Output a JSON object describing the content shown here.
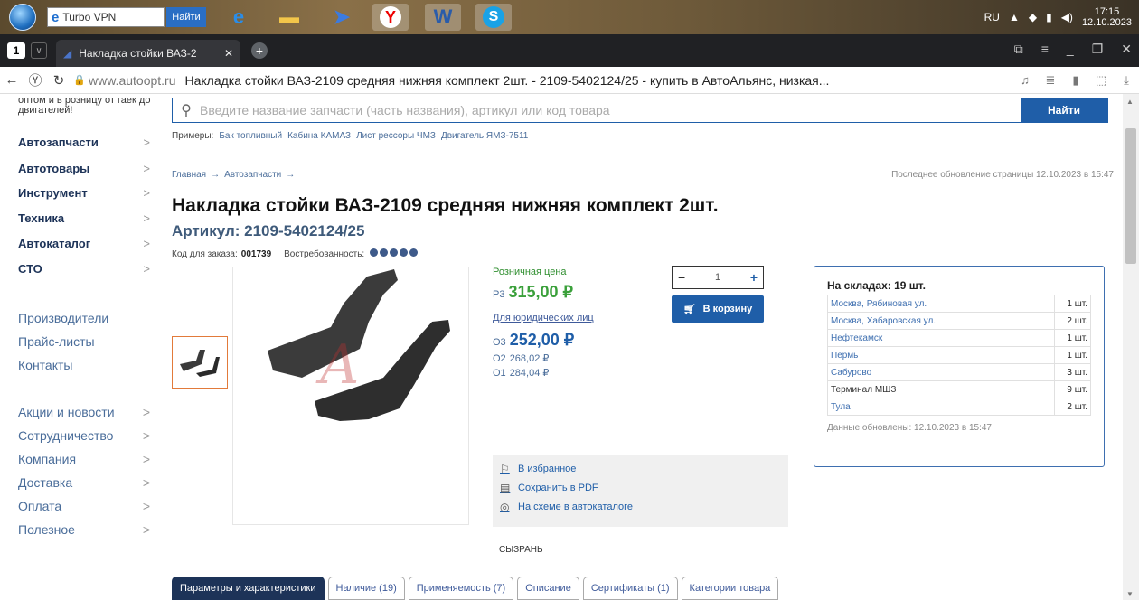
{
  "taskbar": {
    "vpn_label": "Turbo VPN",
    "find_button": "Найти",
    "lang": "RU",
    "time": "17:15",
    "date": "12.10.2023"
  },
  "browser": {
    "tab_count": "1",
    "tab_title": "Накладка стойки ВАЗ-2",
    "domain": "www.autoopt.ru",
    "page_title": "Накладка стойки ВАЗ-2109 средняя нижняя комплект 2шт. - 2109-5402124/25 - купить в АвтоАльянс, низкая..."
  },
  "sidebar": {
    "slogan": "оптом и в розницу от гаек до двигателей!",
    "categories": [
      "Автозапчасти",
      "Автотовары",
      "Инструмент",
      "Техника",
      "Автокаталог",
      "СТО"
    ],
    "links_a": [
      "Производители",
      "Прайс-листы",
      "Контакты"
    ],
    "links_b": [
      "Акции и новости",
      "Сотрудничество",
      "Компания",
      "Доставка",
      "Оплата",
      "Полезное"
    ]
  },
  "search": {
    "placeholder": "Введите название запчасти (часть названия), артикул или код товара",
    "button": "Найти",
    "examples_label": "Примеры:",
    "examples": [
      "Бак топливный",
      "Кабина КАМАЗ",
      "Лист рессоры ЧМЗ",
      "Двигатель ЯМЗ-7511"
    ]
  },
  "breadcrumb": [
    "Главная",
    "→",
    "Автозапчасти",
    "→"
  ],
  "last_update": "Последнее обновление страницы 12.10.2023 в 15:47",
  "product": {
    "title": "Накладка стойки ВАЗ-2109 средняя нижняя комплект 2шт.",
    "sku": "Артикул: 2109-5402124/25",
    "order_code_label": "Код для заказа:",
    "order_code": "001739",
    "demand_label": "Востребованность:",
    "demand_level": 5,
    "city": "СЫЗРАНЬ"
  },
  "prices": {
    "retail_label": "Розничная цена",
    "retail_code": "Р3",
    "retail": "315,00 ₽",
    "jur_label": "Для юридических лиц",
    "jur_code": "О3",
    "jur": "252,00 ₽",
    "o2_code": "О2",
    "o2": "268,02 ₽",
    "o1_code": "О1",
    "o1": "284,04 ₽"
  },
  "cart": {
    "qty": "1",
    "minus": "−",
    "plus": "+",
    "button": "В корзину"
  },
  "actions": {
    "favorite": "В избранное",
    "pdf": "Сохранить в PDF",
    "scheme": "На схеме в автокаталоге"
  },
  "stock": {
    "title": "На складах: 19 шт.",
    "rows": [
      {
        "name": "Москва, Рябиновая ул.",
        "qty": "1 шт."
      },
      {
        "name": "Москва, Хабаровская ул.",
        "qty": "2 шт."
      },
      {
        "name": "Нефтекамск",
        "qty": "1 шт."
      },
      {
        "name": "Пермь",
        "qty": "1 шт."
      },
      {
        "name": "Сабурово",
        "qty": "3 шт."
      },
      {
        "name": "Терминал МШЗ",
        "qty": "9 шт."
      },
      {
        "name": "Тула",
        "qty": "2 шт."
      }
    ],
    "updated": "Данные обновлены: 12.10.2023 в 15:47"
  },
  "tabs": [
    "Параметры и характеристики",
    "Наличие (19)",
    "Применяемость (7)",
    "Описание",
    "Сертификаты (1)",
    "Категории товара"
  ]
}
